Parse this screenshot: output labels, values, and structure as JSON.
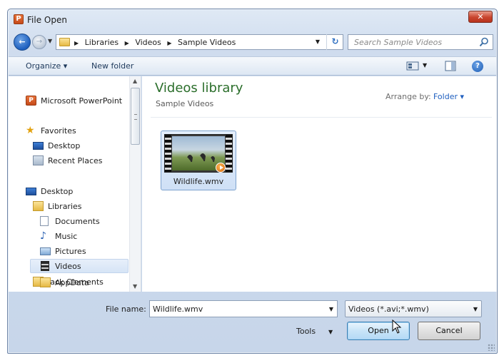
{
  "window": {
    "title": "File Open",
    "app_icon_letter": "P",
    "close_glyph": "✕"
  },
  "address_bar": {
    "crumbs": [
      "Libraries",
      "Videos",
      "Sample Videos"
    ]
  },
  "search": {
    "placeholder": "Search Sample Videos"
  },
  "toolbar": {
    "organize_label": "Organize ▾",
    "new_folder_label": "New folder",
    "help_glyph": "?"
  },
  "nav_pane": {
    "items": [
      {
        "label": "Microsoft PowerPoint",
        "icon": "powerpoint-icon"
      },
      {
        "label": "Favorites",
        "icon": "star-icon"
      },
      {
        "label": "Desktop",
        "icon": "desktop-icon"
      },
      {
        "label": "Recent Places",
        "icon": "recent-places-icon"
      },
      {
        "label": "Desktop",
        "icon": "desktop-icon"
      },
      {
        "label": "Libraries",
        "icon": "libraries-icon"
      },
      {
        "label": "Documents",
        "icon": "documents-icon"
      },
      {
        "label": "Music",
        "icon": "music-icon"
      },
      {
        "label": "Pictures",
        "icon": "pictures-icon"
      },
      {
        "label": "Videos",
        "icon": "videos-icon",
        "selected": true
      },
      {
        "label": "Jack Clements",
        "icon": "user-folder-icon"
      },
      {
        "label": "AppData",
        "icon": "folder-icon"
      }
    ]
  },
  "content": {
    "library_title": "Videos library",
    "library_subtitle": "Sample Videos",
    "arrange_label": "Arrange by:",
    "arrange_value": "Folder ▾",
    "files": [
      {
        "name": "Wildlife.wmv",
        "selected": true
      }
    ]
  },
  "bottom": {
    "file_name_label": "File name:",
    "file_name_value": "Wildlife.wmv",
    "file_type_value": "Videos (*.avi;*.wmv)",
    "tools_label": "Tools",
    "open_label": "Open",
    "cancel_label": "Cancel"
  },
  "colors": {
    "library_title": "#2b6e2b",
    "link_blue": "#1f5fbf",
    "selection": "#d6e4f6"
  }
}
